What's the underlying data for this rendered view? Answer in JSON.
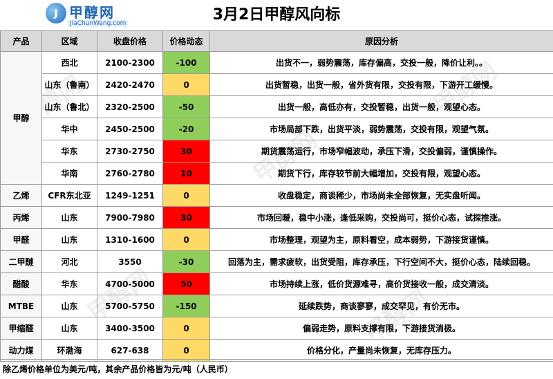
{
  "header": {
    "title": "3月2日甲醇风向标",
    "logo_name": "甲醇网",
    "logo_url": "JiaChunWang.com",
    "logo_mark": "J"
  },
  "columns": [
    "产品",
    "区域",
    "收盘价格",
    "价格动态",
    "原因分析"
  ],
  "rows": [
    {
      "product": "甲醇",
      "region": "西北",
      "price": "2100-2300",
      "change": "-100",
      "status": "green",
      "reason": "出货不一，弱势震荡，库存偏高，交投一般，降价让利。。"
    },
    {
      "product": "",
      "region": "山东（鲁南）",
      "price": "2420-2470",
      "change": "0",
      "status": "yellow",
      "reason": "出货暂稳，出货一般，省外货有限，交投有限，下游开工缓慢。"
    },
    {
      "product": "",
      "region": "山东（鲁北）",
      "price": "2320-2500",
      "change": "-50",
      "status": "green",
      "reason": "出货一般，高低亦有，交投暂稳，出货一般，观望心态。"
    },
    {
      "product": "",
      "region": "华中",
      "price": "2450-2500",
      "change": "-20",
      "status": "green",
      "reason": "市场局部下跌，出货平淡，弱势震荡，交投有限，观望气氛。"
    },
    {
      "product": "",
      "region": "华东",
      "price": "2730-2750",
      "change": "30",
      "status": "red",
      "reason": "期货震荡运行，市场窄幅波动，承压下滑，交投偏弱，谨慎操作。"
    },
    {
      "product": "",
      "region": "华南",
      "price": "2760-2780",
      "change": "10",
      "status": "red",
      "reason": "期货下行，库存较节前大幅增加，交投有限，观望心态。"
    },
    {
      "product": "乙烯",
      "region": "CFR东北亚",
      "price": "1249-1251",
      "change": "0",
      "status": "yellow",
      "reason": "收盘稳定，商谈稀少，市场尚未全部恢复，无实盘听闻。"
    },
    {
      "product": "丙烯",
      "region": "山东",
      "price": "7900-7980",
      "change": "30",
      "status": "red",
      "reason": "市场回暖，稳中小涨，逢低采购，交投尚可，挺价心态，试探推涨。"
    },
    {
      "product": "甲醛",
      "region": "山东",
      "price": "1310-1600",
      "change": "0",
      "status": "yellow",
      "reason": "市场整理，观望为主，原料看空，成本弱势，下游接货谨慎。"
    },
    {
      "product": "二甲醚",
      "region": "河北",
      "price": "3550",
      "change": "-30",
      "status": "green",
      "reason": "回落为主，需求疲软，出货受阻，库存承压，下行空间不大，挺价心态，陆续回稳。"
    },
    {
      "product": "醋酸",
      "region": "华东",
      "price": "4700-5000",
      "change": "50",
      "status": "red",
      "reason": "市场持续上涨，低价货源难寻，高价货接收一般，成交清淡。"
    },
    {
      "product": "MTBE",
      "region": "山东",
      "price": "5700-5750",
      "change": "-150",
      "status": "green",
      "reason": "延续跌势，商谈寥寥，成交罕见，有价无市。"
    },
    {
      "product": "甲缩醛",
      "region": "山东",
      "price": "3400-3500",
      "change": "0",
      "status": "yellow",
      "reason": "偏弱走势，原料支撑有限，下游接货消极。"
    },
    {
      "product": "动力煤",
      "region": "环渤海",
      "price": "627-638",
      "change": "0",
      "status": "yellow",
      "reason": "价格分化，产量尚未恢复，无库存压力。"
    }
  ],
  "footer": "除乙烯价格单位为美元/吨，其余产品价格皆为元/吨（人民币）",
  "colors": {
    "green": "#8fce5a",
    "yellow": "#ffd966",
    "red": "#ff0000",
    "header_bg": "#d9d9d9",
    "brand": "#2166b0"
  }
}
